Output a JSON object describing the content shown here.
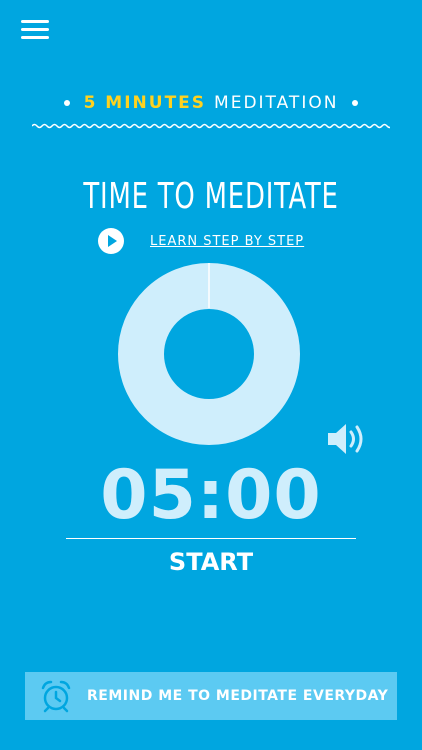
{
  "header": {
    "accent": "5 MINUTES",
    "rest": "MEDITATION"
  },
  "title": "TIME TO MEDITATE",
  "learn_link": "LEARN STEP BY STEP",
  "timer": {
    "display": "05:00",
    "progress": 0.0
  },
  "start_label": "START",
  "remind_label": "REMIND ME TO MEDITATE EVERYDAY",
  "icons": {
    "menu": "hamburger-menu-icon",
    "play": "play-icon",
    "sound": "speaker-volume-icon",
    "alarm": "alarm-clock-icon"
  },
  "colors": {
    "background": "#00a6e0",
    "accent": "#ffd21f",
    "ring": "#cfeefc",
    "remind_button": "#5ccaf2"
  }
}
